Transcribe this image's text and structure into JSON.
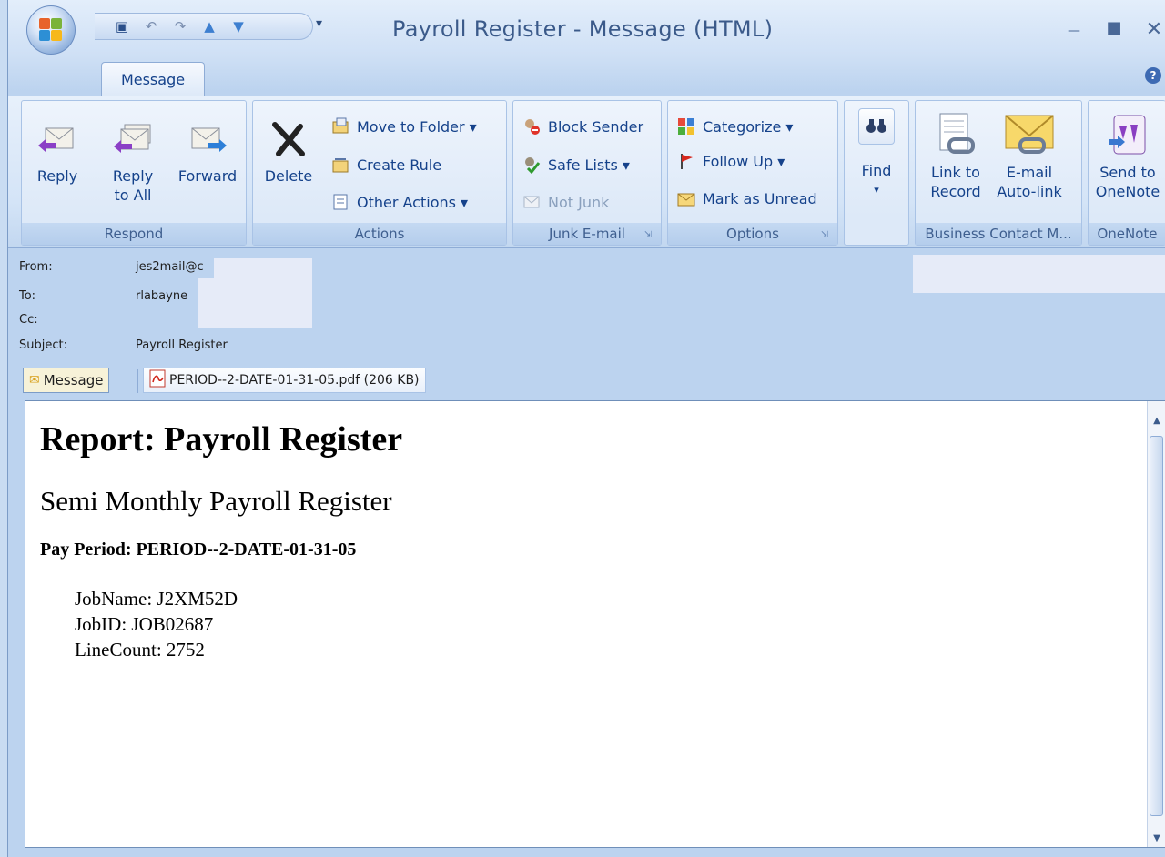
{
  "window": {
    "title": "Payroll Register - Message (HTML)",
    "qat_dropdown": "▾",
    "qat_icons": [
      "save-icon",
      "undo-icon",
      "redo-icon",
      "up-icon",
      "down-icon"
    ],
    "controls": {
      "minimize": "—",
      "maximize": "■",
      "close": "✕"
    }
  },
  "ribbon": {
    "tab_label": "Message",
    "help": "?",
    "groups": {
      "respond": {
        "label": "Respond",
        "reply": "Reply",
        "reply_all_1": "Reply",
        "reply_all_2": "to All",
        "forward": "Forward"
      },
      "actions": {
        "label": "Actions",
        "delete": "Delete",
        "move_to_folder": "Move to Folder ▾",
        "create_rule": "Create Rule",
        "other_actions": "Other Actions ▾"
      },
      "junk": {
        "label": "Junk E-mail",
        "block_sender": "Block Sender",
        "safe_lists": "Safe Lists ▾",
        "not_junk": "Not Junk"
      },
      "options": {
        "label": "Options",
        "categorize": "Categorize ▾",
        "follow_up": "Follow Up ▾",
        "mark_unread": "Mark as Unread"
      },
      "find": {
        "label": "Find",
        "arrow": "▾"
      },
      "business": {
        "label": "Business Contact M...",
        "link_1": "Link to",
        "link_2": "Record",
        "email_1": "E-mail",
        "email_2": "Auto-link"
      },
      "onenote": {
        "label": "OneNote",
        "send_1": "Send to",
        "send_2": "OneNote"
      }
    }
  },
  "header": {
    "from_label": "From:",
    "from_value": "jes2mail@c",
    "to_label": "To:",
    "to_value": "rlabayne",
    "cc_label": "Cc:",
    "cc_value": "",
    "subject_label": "Subject:",
    "subject_value": "Payroll Register"
  },
  "attachments": {
    "message_tab": "Message",
    "file": "PERIOD--2-DATE-01-31-05.pdf (206 KB)"
  },
  "body": {
    "title": "Report: Payroll Register",
    "subtitle": "Semi Monthly Payroll Register",
    "pay_period": "Pay Period: PERIOD--2-DATE-01-31-05",
    "job_name": "JobName: J2XM52D",
    "job_id": "JobID: JOB02687",
    "line_count": "LineCount: 2752"
  },
  "colors": {
    "ribbon_text": "#15428b",
    "group_label": "#3f5f8f",
    "delete_x": "#222222",
    "accent": "#3d6ab3"
  }
}
